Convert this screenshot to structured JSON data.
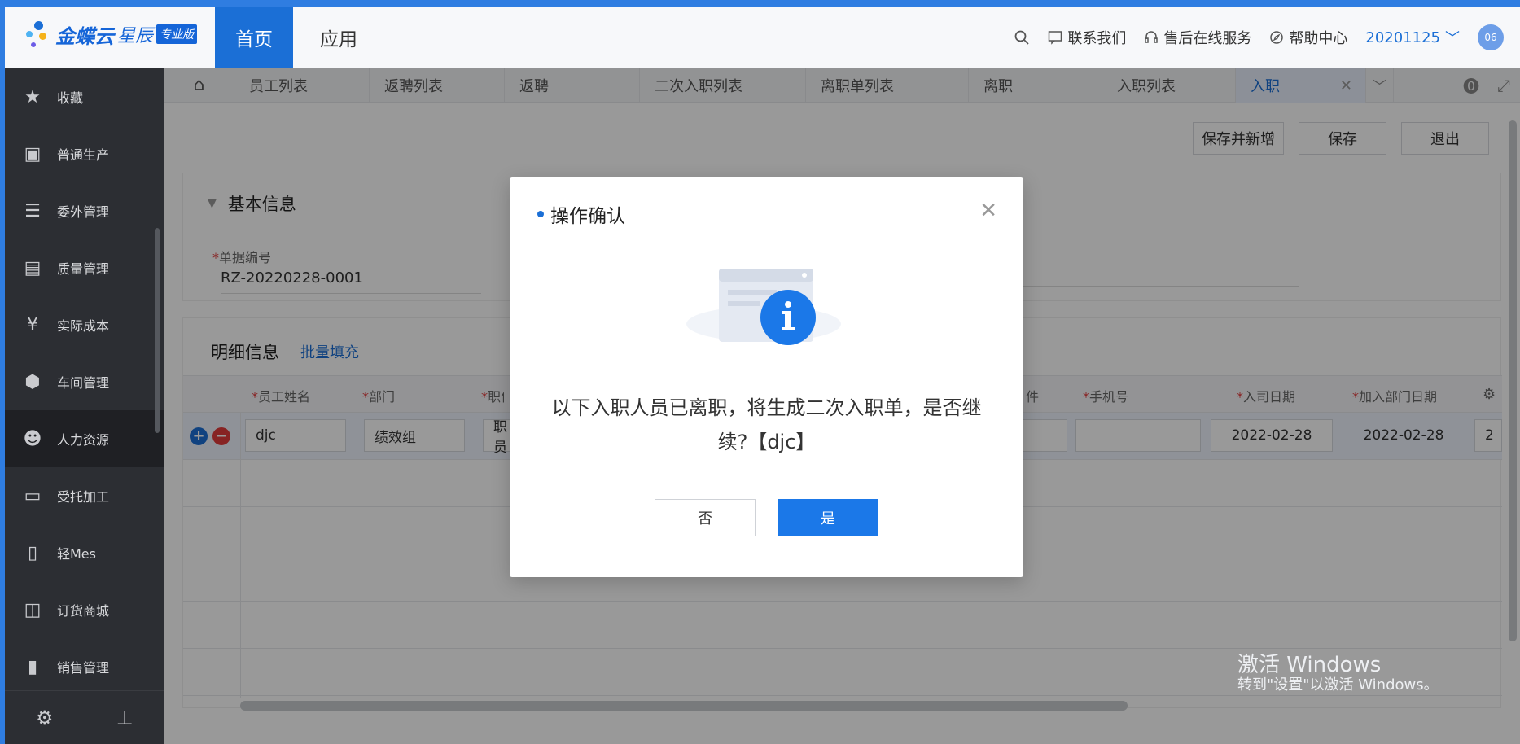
{
  "header": {
    "logo_text": "金蝶云",
    "logo_sub": "星辰",
    "logo_badge": "专业版",
    "nav_home": "首页",
    "nav_app": "应用",
    "contact": "联系我们",
    "after_sales": "售后在线服务",
    "help": "帮助中心",
    "user": "20201125",
    "avatar_text": "06"
  },
  "sidebar": {
    "items": [
      {
        "label": "收藏",
        "icon": "star-icon"
      },
      {
        "label": "普通生产",
        "icon": "monitor-icon"
      },
      {
        "label": "委外管理",
        "icon": "stack-icon"
      },
      {
        "label": "质量管理",
        "icon": "inspect-icon"
      },
      {
        "label": "实际成本",
        "icon": "yen-icon"
      },
      {
        "label": "车间管理",
        "icon": "cube-icon"
      },
      {
        "label": "人力资源",
        "icon": "person-add-icon"
      },
      {
        "label": "受托加工",
        "icon": "box-icon"
      },
      {
        "label": "轻Mes",
        "icon": "phone-icon"
      },
      {
        "label": "订货商城",
        "icon": "cart-icon"
      },
      {
        "label": "销售管理",
        "icon": "bar-chart-icon"
      }
    ]
  },
  "tabs": [
    "员工列表",
    "返聘列表",
    "返聘",
    "二次入职列表",
    "离职单列表",
    "离职",
    "入职列表",
    "入职"
  ],
  "toolbar": {
    "save_new": "保存并新增",
    "save": "保存",
    "exit": "退出"
  },
  "basic_info": {
    "title": "基本信息",
    "doc_no_label": "单据编号",
    "doc_no_value": "RZ-20220228-0001"
  },
  "detail": {
    "title": "明细信息",
    "batch_fill": "批量填充",
    "headers": [
      "员工姓名",
      "部门",
      "职位",
      "件",
      "手机号",
      "入司日期",
      "加入部门日期"
    ],
    "row": {
      "name": "djc",
      "dept": "绩效组",
      "position": "职员",
      "join_date": "2022-02-28",
      "dept_join_date": "2022-02-28",
      "extra": "2"
    }
  },
  "watermark": {
    "line1": "激活 Windows",
    "line2": "转到\"设置\"以激活 Windows。"
  },
  "modal": {
    "title": "操作确认",
    "message": "以下入职人员已离职，将生成二次入职单，是否继续?【djc】",
    "no": "否",
    "yes": "是"
  },
  "colors": {
    "primary": "#1b78e8",
    "sidebar": "#2c2e33",
    "frame": "#2f7de1",
    "required": "#e23b3b"
  }
}
